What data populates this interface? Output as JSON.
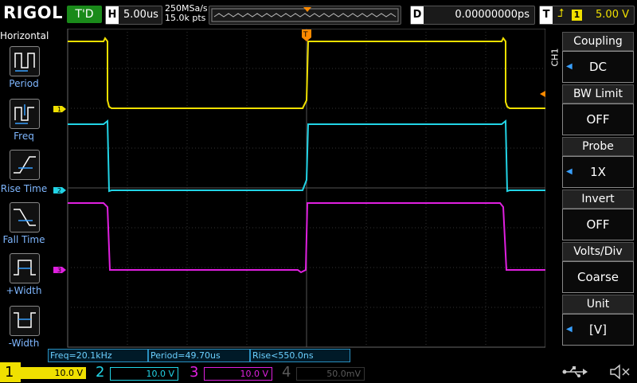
{
  "brand": "RIGOL",
  "run_status": "T'D",
  "timebase": {
    "key": "H",
    "value": "5.00us"
  },
  "acquisition": {
    "sample_rate": "250MSa/s",
    "memory_depth": "15.0k pts"
  },
  "delay": {
    "key": "D",
    "value": "0.00000000ps"
  },
  "trigger": {
    "key": "T",
    "source": "1",
    "level": "5.00 V"
  },
  "horizontal_menu": {
    "title": "Horizontal",
    "items": [
      "Period",
      "Freq",
      "Rise Time",
      "Fall Time",
      "+Width",
      "-Width"
    ]
  },
  "channel_menu": {
    "channel_tag": "CH1",
    "items": [
      {
        "title": "Coupling",
        "value": "DC"
      },
      {
        "title": "BW Limit",
        "value": "OFF"
      },
      {
        "title": "Probe",
        "value": "1X"
      },
      {
        "title": "Invert",
        "value": "OFF"
      },
      {
        "title": "Volts/Div",
        "value": "Coarse"
      },
      {
        "title": "Unit",
        "value": "[V]"
      }
    ]
  },
  "measurements": {
    "freq": "Freq=20.1kHz",
    "period": "Period=49.70us",
    "rise": "Rise<550.0ns"
  },
  "channels": [
    {
      "num": "1",
      "scale": "10.0 V",
      "color": "#f0e000"
    },
    {
      "num": "2",
      "scale": "10.0 V",
      "color": "#22d4e6"
    },
    {
      "num": "3",
      "scale": "10.0 V",
      "color": "#e020e0"
    },
    {
      "num": "4",
      "scale": "50.0mV",
      "color": "#5a5a5a"
    }
  ],
  "markers": {
    "ch1": "1",
    "ch2": "2",
    "ch3": "3",
    "trigger": "T"
  },
  "colors": {
    "ch1": "#f0e000",
    "ch2": "#22d4e6",
    "ch3": "#e020e0",
    "trigger_marker": "#ff8a00",
    "menu_accent": "#39a0ff"
  }
}
